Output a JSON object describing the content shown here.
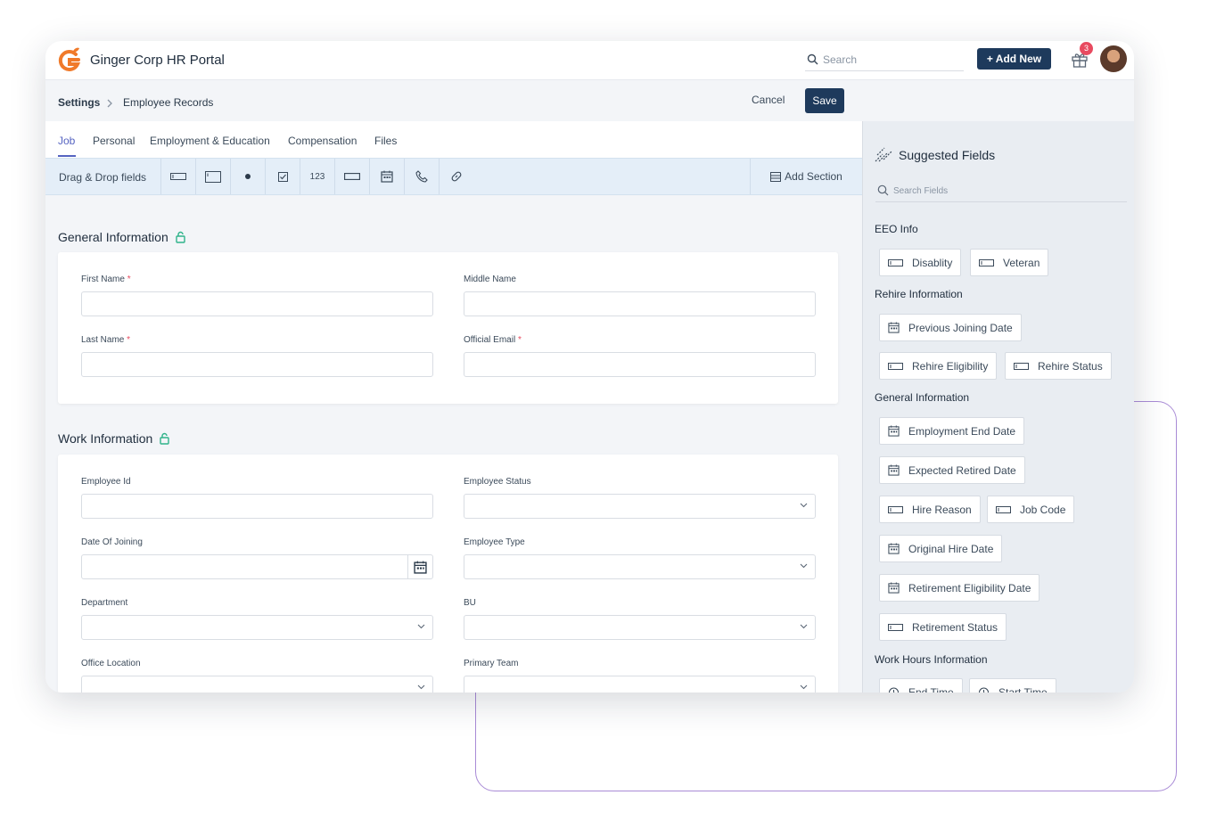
{
  "app": {
    "title": "Ginger Corp HR Portal"
  },
  "header": {
    "search_placeholder": "Search",
    "add_new_label": "+ Add New",
    "notification_count": "3"
  },
  "breadcrumb": {
    "root": "Settings",
    "current": "Employee Records"
  },
  "actions": {
    "cancel_label": "Cancel",
    "save_label": "Save"
  },
  "tabs": [
    {
      "label": "Job",
      "active": true
    },
    {
      "label": "Personal",
      "active": false
    },
    {
      "label": "Employment & Education",
      "active": false
    },
    {
      "label": "Compensation",
      "active": false
    },
    {
      "label": "Files",
      "active": false
    }
  ],
  "toolbar": {
    "label": "Drag & Drop fields",
    "tools": [
      "text-field-icon",
      "textarea-icon",
      "radio-icon",
      "checkbox-icon",
      "number-icon",
      "dropdown-icon",
      "calendar-icon",
      "phone-icon",
      "link-icon"
    ],
    "number_glyph": "123",
    "add_section_label": "Add Section"
  },
  "general_info": {
    "title": "General Information",
    "fields": [
      {
        "label": "First Name",
        "required": true
      },
      {
        "label": "Middle Name",
        "required": false
      },
      {
        "label": "Last Name",
        "required": true
      },
      {
        "label": "Official Email",
        "required": true
      }
    ]
  },
  "work_info": {
    "title": "Work Information",
    "fields": [
      {
        "label": "Employee Id",
        "kind": "text"
      },
      {
        "label": "Employee Status",
        "kind": "select"
      },
      {
        "label": "Date Of Joining",
        "kind": "date"
      },
      {
        "label": "Employee Type",
        "kind": "select"
      },
      {
        "label": "Department",
        "kind": "select"
      },
      {
        "label": "BU",
        "kind": "select"
      },
      {
        "label": "Office Location",
        "kind": "select"
      },
      {
        "label": "Primary Team",
        "kind": "select"
      }
    ]
  },
  "required_marker": "*",
  "suggested": {
    "title": "Suggested Fields",
    "search_placeholder": "Search Fields",
    "groups": [
      {
        "title": "EEO Info",
        "chips": [
          {
            "label": "Disablity",
            "icon": "text-field-icon"
          },
          {
            "label": "Veteran",
            "icon": "text-field-icon"
          }
        ]
      },
      {
        "title": "Rehire Information",
        "chips": [
          {
            "label": "Previous Joining Date",
            "icon": "calendar-icon"
          },
          {
            "label": "Rehire Eligibility",
            "icon": "text-field-icon"
          },
          {
            "label": "Rehire Status",
            "icon": "text-field-icon"
          }
        ]
      },
      {
        "title": "General Information",
        "chips": [
          {
            "label": "Employment End Date",
            "icon": "calendar-icon"
          },
          {
            "label": "Expected Retired Date",
            "icon": "calendar-icon"
          },
          {
            "label": "Hire Reason",
            "icon": "text-field-icon"
          },
          {
            "label": "Job Code",
            "icon": "text-field-icon"
          },
          {
            "label": "Original Hire Date",
            "icon": "calendar-icon"
          },
          {
            "label": "Retirement Eligibility Date",
            "icon": "calendar-icon"
          },
          {
            "label": "Retirement Status",
            "icon": "text-field-icon"
          }
        ]
      },
      {
        "title": "Work Hours Information",
        "chips": [
          {
            "label": "End Time",
            "icon": "clock-icon"
          },
          {
            "label": "Start Time",
            "icon": "clock-icon"
          }
        ]
      }
    ]
  },
  "colors": {
    "primary": "#1e3a5c",
    "accent": "#5563c1",
    "lock": "#2fb38a",
    "badge": "#e84a5f",
    "brand_orange": "#f07a2a"
  }
}
